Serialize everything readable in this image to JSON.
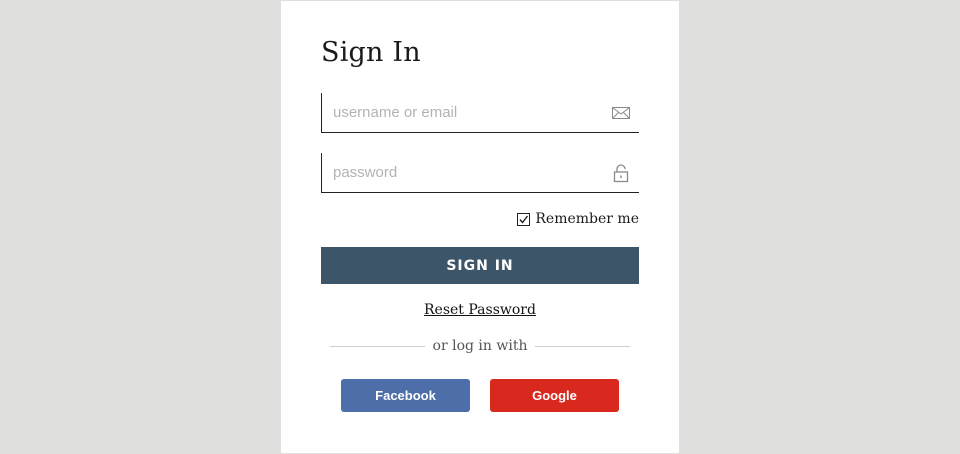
{
  "signin_form": {
    "title": "Sign In",
    "username": {
      "value": "",
      "placeholder": "username or email",
      "icon": "envelope-icon"
    },
    "password": {
      "value": "",
      "placeholder": "password",
      "icon": "unlock-icon"
    },
    "remember_me": {
      "label": "Remember me",
      "checked": true
    },
    "submit_label": "SIGN IN",
    "reset_password_label": "Reset Password",
    "divider_text": "or log in with",
    "social": {
      "facebook_label": "Facebook",
      "google_label": "Google"
    }
  },
  "colors": {
    "background": "#dfdfdd",
    "card": "#ffffff",
    "primary_button": "#3d5569",
    "facebook": "#4e6eaa",
    "google": "#d9291f"
  }
}
